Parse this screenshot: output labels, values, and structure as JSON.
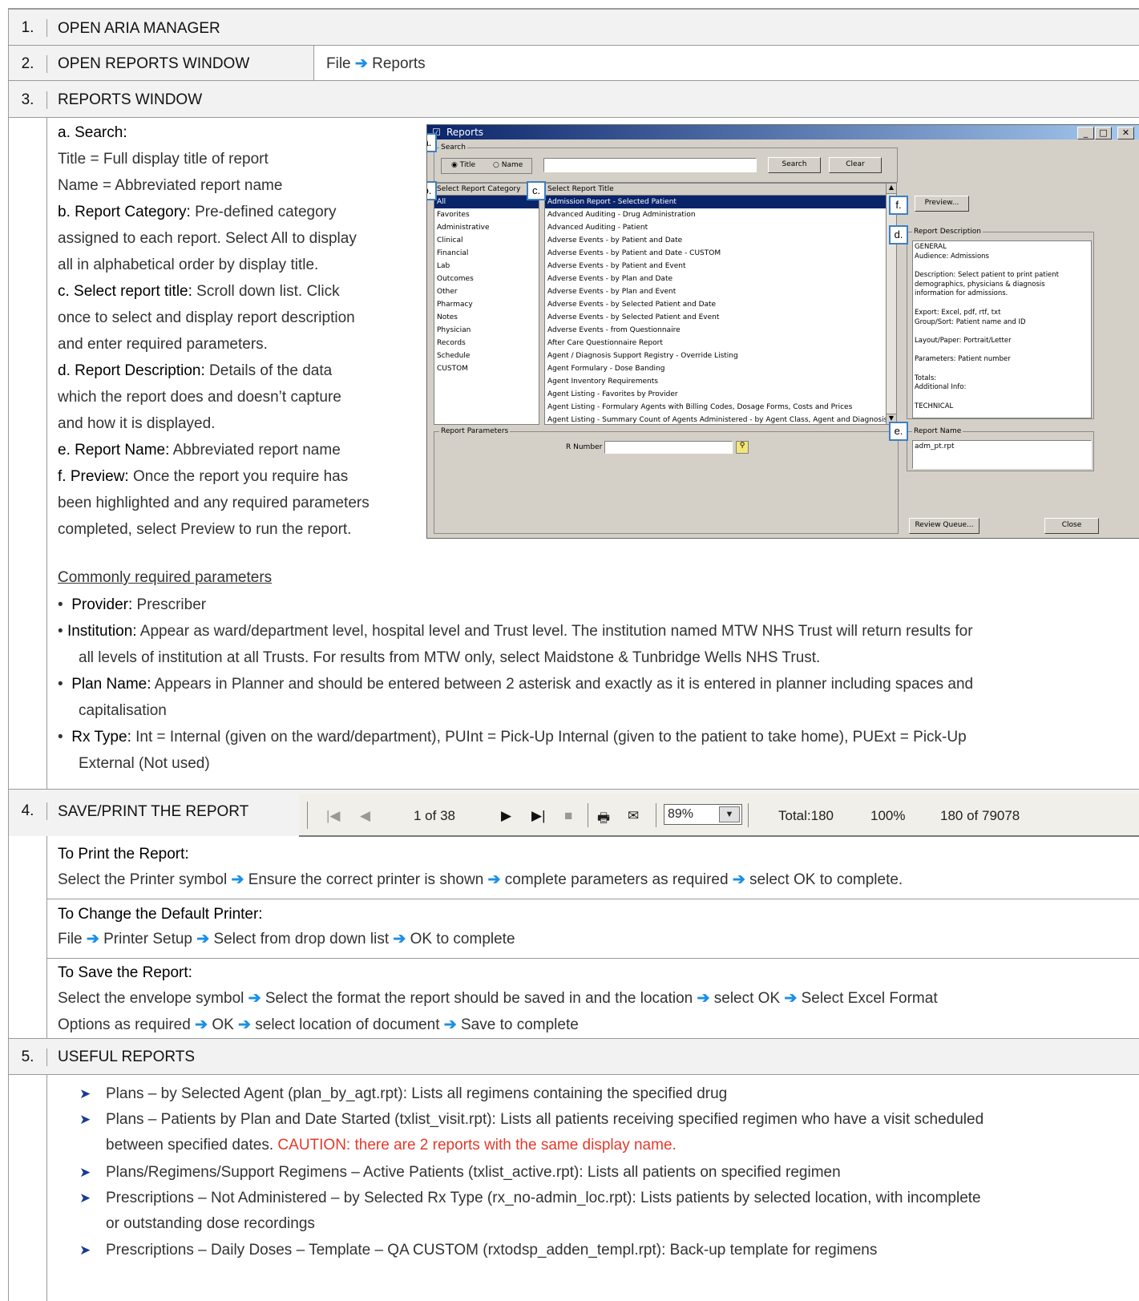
{
  "steps": [
    {
      "num": "1.",
      "title": "OPEN ARIA MANAGER"
    },
    {
      "num": "2.",
      "title": "OPEN REPORTS WINDOW",
      "path_a": "File",
      "path_b": "Reports"
    },
    {
      "num": "3.",
      "title": "REPORTS WINDOW"
    },
    {
      "num": "4.",
      "title": "SAVE/PRINT THE REPORT"
    },
    {
      "num": "5.",
      "title": "USEFUL REPORTS"
    }
  ],
  "step3": {
    "a_label": "a.  Search:",
    "a_line1": "Title = Full display title of report",
    "a_line2": "Name = Abbreviated report name",
    "b_label": "b.  Report Category:",
    "b_text": " Pre-defined category",
    "b_line2": "assigned to each report. Select All to display",
    "b_line3": "all in alphabetical order by display title.",
    "c_label": "c.  Select report title:",
    "c_text": " Scroll down list. Click",
    "c_line2": "once to select and display report description",
    "c_line3": "and enter required parameters.",
    "d_label": "d.  Report Description:",
    "d_text": " Details of the data",
    "d_line2": "which the report does and doesn’t capture",
    "d_line3": "and how it is displayed.",
    "e_label": "e.  Report Name:",
    "e_text": " Abbreviated report name",
    "f_label": "f.   Preview:",
    "f_text": " Once the report you require has",
    "f_line2": "been highlighted and any required parameters",
    "f_line3": "completed, select Preview to run the report.",
    "params_heading": "Commonly required parameters",
    "bullets": [
      {
        "label": "Provider:",
        "text": " Prescriber",
        "line2": ""
      },
      {
        "label": "Institution:",
        "text": " Appear as ward/department level, hospital level and Trust level. The institution named MTW NHS Trust will return results for",
        "line2": "all levels of institution at all Trusts. For results from MTW only, select Maidstone & Tunbridge Wells NHS Trust."
      },
      {
        "label": "Plan Name:",
        "text": " Appears in Planner and should be entered between 2 asterisk and exactly as it is entered in planner including spaces and",
        "line2": "capitalisation"
      },
      {
        "label": "Rx Type:",
        "text": " Int = Internal (given on the ward/department), PUInt = Pick-Up Internal (given to the patient to take home), PUExt = Pick-Up",
        "line2": "External (Not used)"
      }
    ]
  },
  "reports_window": {
    "title": "Reports",
    "search_group": "Search",
    "radio_title": "Title",
    "radio_name": "Name",
    "search_btn": "Search",
    "clear_btn": "Clear",
    "category_header": "Select Report Category",
    "categories": [
      "All",
      "Favorites",
      "Administrative",
      "Clinical",
      "Financial",
      "Lab",
      "Outcomes",
      "Other",
      "Pharmacy",
      "Notes",
      "Physician",
      "Records",
      "Schedule",
      "CUSTOM"
    ],
    "title_header": "Select Report Title",
    "titles": [
      "Admission Report - Selected Patient",
      "Advanced Auditing - Drug Administration",
      "Advanced Auditing - Patient",
      "Adverse Events - by Patient and Date",
      "Adverse Events - by Patient and Date - CUSTOM",
      "Adverse Events - by Patient and Event",
      "Adverse Events - by Plan and Date",
      "Adverse Events - by Plan and Event",
      "Adverse Events - by Selected Patient and Date",
      "Adverse Events - by Selected Patient and Event",
      "Adverse Events - from Questionnaire",
      "After Care Questionnaire Report",
      "Agent / Diagnosis Support Registry - Override Listing",
      "Agent Formulary - Dose Banding",
      "Agent Inventory Requirements",
      "Agent Listing - Favorites by Provider",
      "Agent Listing - Formulary Agents with Billing Codes, Dosage Forms, Costs and Prices",
      "Agent Listing - Summary Count of Agents Administered - by Agent Class, Agent and Diagnosis"
    ],
    "preview_btn": "Preview...",
    "desc_group": "Report Description",
    "desc_lines": [
      "GENERAL",
      "Audience: Admissions",
      "",
      "Description: Select patient to print patient",
      "demographics, physicians & diagnosis",
      "information for admissions.",
      "",
      "Export: Excel, pdf, rtf, txt",
      "Group/Sort: Patient name and ID",
      "",
      "Layout/Paper: Portrait/Letter",
      "",
      "Parameters: Patient number",
      "",
      "Totals:",
      "Additional Info:",
      "",
      "TECHNICAL"
    ],
    "params_group": "Report Parameters",
    "r_number_label": "R Number",
    "name_group": "Report Name",
    "report_name": "adm_pt.rpt",
    "review_btn": "Review Queue...",
    "close_btn": "Close",
    "tags": [
      "a.",
      "b.",
      "c.",
      "d.",
      "e.",
      "f."
    ]
  },
  "toolbar": {
    "page": "1 of 38",
    "zoom": "89%",
    "total": "Total:180",
    "percent": "100%",
    "count": "180 of 79078"
  },
  "step4": {
    "print_heading": "To Print the Report:",
    "print_steps": [
      "Select the Printer symbol",
      "Ensure the correct printer is shown",
      "complete parameters as required",
      "select OK to complete."
    ],
    "default_heading": "To Change the Default Printer:",
    "default_steps": [
      "File",
      "Printer Setup",
      "Select from drop down list",
      "OK to complete"
    ],
    "save_heading": "To Save the Report:",
    "save_steps_l1": [
      "Select the envelope symbol",
      "Select the format the report should be saved in and the location",
      "select OK",
      "Select Excel Format"
    ],
    "save_steps_l2": [
      "Options as required",
      "OK",
      "select location of document",
      "Save to complete"
    ]
  },
  "useful_reports": [
    {
      "text": "Plans – by Selected Agent (plan_by_agt.rpt): Lists all regimens containing the specified drug",
      "line2": "",
      "caution": ""
    },
    {
      "text": "Plans – Patients by Plan and Date Started (txlist_visit.rpt): Lists all patients receiving specified regimen who have a visit scheduled",
      "line2": "between specified dates. ",
      "caution": "CAUTION: there are 2 reports with the same display name."
    },
    {
      "text": "Plans/Regimens/Support Regimens – Active Patients (txlist_active.rpt): Lists all patients on specified regimen",
      "line2": "",
      "caution": ""
    },
    {
      "text": "Prescriptions – Not Administered – by Selected Rx Type (rx_no-admin_loc.rpt): Lists patients by selected location, with incomplete",
      "line2": "or outstanding dose recordings",
      "caution": ""
    },
    {
      "text": "Prescriptions – Daily Doses – Template – QA CUSTOM (rxtodsp_adden_templ.rpt): Back-up template for regimens",
      "line2": "",
      "caution": ""
    }
  ]
}
